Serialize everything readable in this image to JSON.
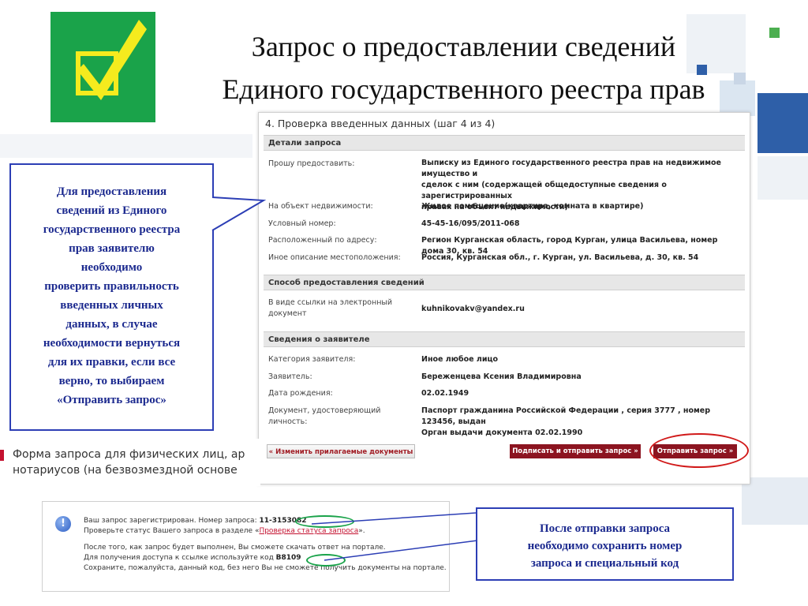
{
  "slide": {
    "title_line1": "Запрос о предоставлении сведений",
    "title_line2": "Единого государственного реестра прав"
  },
  "colors": {
    "logo_green": "#1aa34a",
    "check_yellow": "#f5eb1e",
    "callout_blue": "#2c3eb5",
    "button_red": "#8c1420"
  },
  "screenshot": {
    "step_title": "4. Проверка введенных данных (шаг 4 из 4)",
    "sections": {
      "details": "Детали запроса",
      "delivery": "Способ предоставления сведений",
      "applicant": "Сведения о заявителе"
    },
    "details": {
      "request_label": "Прошу предоставить:",
      "request_value": [
        "Выписку из Единого государственного реестра прав на недвижимое имущество и",
        "сделок с ним (содержащей общедоступные сведения о зарегистрированных",
        "правах на объект недвижимости)"
      ],
      "object_label": "На объект недвижимости:",
      "object_value": "Жилое помещение(квартира, комната в квартире)",
      "number_label": "Условный номер:",
      "number_value": "45-45-16/095/2011-068",
      "address_label": "Расположенный по адресу:",
      "address_value": "Регион Курганская область, город Курган, улица Васильева, номер дома 30, кв. 54",
      "location_label": "Иное описание местоположения:",
      "location_value": "Россия, Курганская обл., г. Курган, ул. Васильева, д. 30, кв. 54"
    },
    "delivery": {
      "link_label": [
        "В виде ссылки на электронный",
        "документ"
      ],
      "link_value": "kuhnikovakv@yandex.ru"
    },
    "applicant": {
      "category_label": "Категория заявителя:",
      "category_value": "Иное любое лицо",
      "name_label": "Заявитель:",
      "name_value": "Береженцева Ксения Владимировна",
      "birth_label": "Дата рождения:",
      "birth_value": "02.02.1949",
      "doc_label": "Документ, удостоверяющий личность:",
      "doc_value": [
        "Паспорт гражданина Российской Федерации , серия 3777 , номер 123456, выдан",
        "Орган выдачи документа 02.02.1990"
      ]
    },
    "buttons": {
      "change_docs": "« Изменить прилагаемые документы",
      "sign_send": "Подписать и отправить запрос »",
      "send": "Отправить запрос »"
    }
  },
  "callout_left": [
    "Для предоставления",
    "сведений из Единого",
    "государственного реестра",
    "прав заявителю",
    "необходимо",
    "проверить правильность",
    "введенных личных",
    "данных, в случае",
    "необходимости вернуться",
    "для их правки, если все",
    "верно, то выбираем",
    "«Отправить запрос»"
  ],
  "form_strip": {
    "line1": "Форма запроса для физических лиц, ар",
    "line2": "нотариусов (на безвозмездной основе"
  },
  "notice": {
    "line1_prefix": "Ваш запрос зарегистрирован. Номер запроса: ",
    "request_number": "11-3153082",
    "line2_prefix": "Проверьте статус Вашего запроса в разделе «",
    "status_link": "Проверка статуса запроса",
    "line2_suffix": "».",
    "line3": "После того, как запрос будет выполнен, Вы сможете скачать ответ на портале.",
    "line4_prefix": "Для получения доступа к ссылке используйте код ",
    "access_code": "B8109",
    "line5": "Сохраните, пожалуйста, данный код, без него Вы не сможете получить документы на портале."
  },
  "callout_right": [
    "После отправки запроса",
    "необходимо сохранить номер",
    "запроса и специальный код"
  ]
}
